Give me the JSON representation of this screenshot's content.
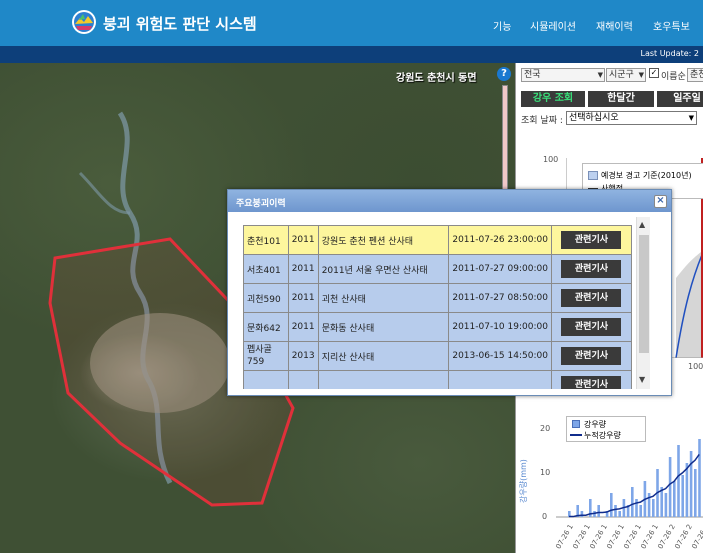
{
  "header": {
    "title": "붕괴 위험도 판단 시스템",
    "nav": [
      "기능",
      "시뮬레이션",
      "재해이력",
      "호우특보"
    ],
    "last_update": "Last Update: 2"
  },
  "map": {
    "location_label": "강원도 춘천시 동면",
    "help": "?"
  },
  "panel": {
    "region_select": "전국",
    "district_select": "시군구",
    "name_order_label": "이름순",
    "city_partial": "춘천",
    "tabs": [
      "강우 조회",
      "한달간",
      "일주일"
    ],
    "date_label": "조회 날짜 :",
    "date_select": "선택하십시오",
    "chart1": {
      "y_top": "100",
      "x_bottom": "100",
      "legend": [
        "예경보 경고 기준(2010년)",
        "사행정"
      ]
    },
    "chart2": {
      "legend": [
        "강우량",
        "누적강우량"
      ],
      "ylabel": "강우량(mm)",
      "yticks": [
        "20",
        "10",
        "0"
      ],
      "x_labels": [
        "07-26 1",
        "07-26 1",
        "07-26 1",
        "07-26 1",
        "07-26 1",
        "07-26 1",
        "07-26 2",
        "07-26 2",
        "07-26 2"
      ]
    }
  },
  "modal": {
    "title": "주요붕괴이력",
    "close": "×",
    "rows": [
      {
        "id": "춘천101",
        "year": "2011",
        "name": "강원도 춘천 펜션 산사태",
        "datetime": "2011-07-26 23:00:00",
        "btn": "관련기사"
      },
      {
        "id": "서초401",
        "year": "2011",
        "name": "2011년 서울 우면산 산사태",
        "datetime": "2011-07-27 09:00:00",
        "btn": "관련기사"
      },
      {
        "id": "괴천590",
        "year": "2011",
        "name": "괴천 산사태",
        "datetime": "2011-07-27 08:50:00",
        "btn": "관련기사"
      },
      {
        "id": "문화642",
        "year": "2011",
        "name": "문화동 산사태",
        "datetime": "2011-07-10 19:00:00",
        "btn": "관련기사"
      },
      {
        "id": "펩사골 759",
        "year": "2013",
        "name": "지리산 산사태",
        "datetime": "2013-06-15 14:50:00",
        "btn": "관련기사"
      },
      {
        "id": "",
        "year": "",
        "name": "",
        "datetime": "",
        "btn": "관련기사"
      }
    ]
  },
  "colors": {
    "header_bg": "#1f88c8",
    "subbar_bg": "#0d3f7a",
    "row_highlight": "#fdf69d",
    "row_normal": "#b7ccec",
    "boundary": "#e0303a"
  }
}
